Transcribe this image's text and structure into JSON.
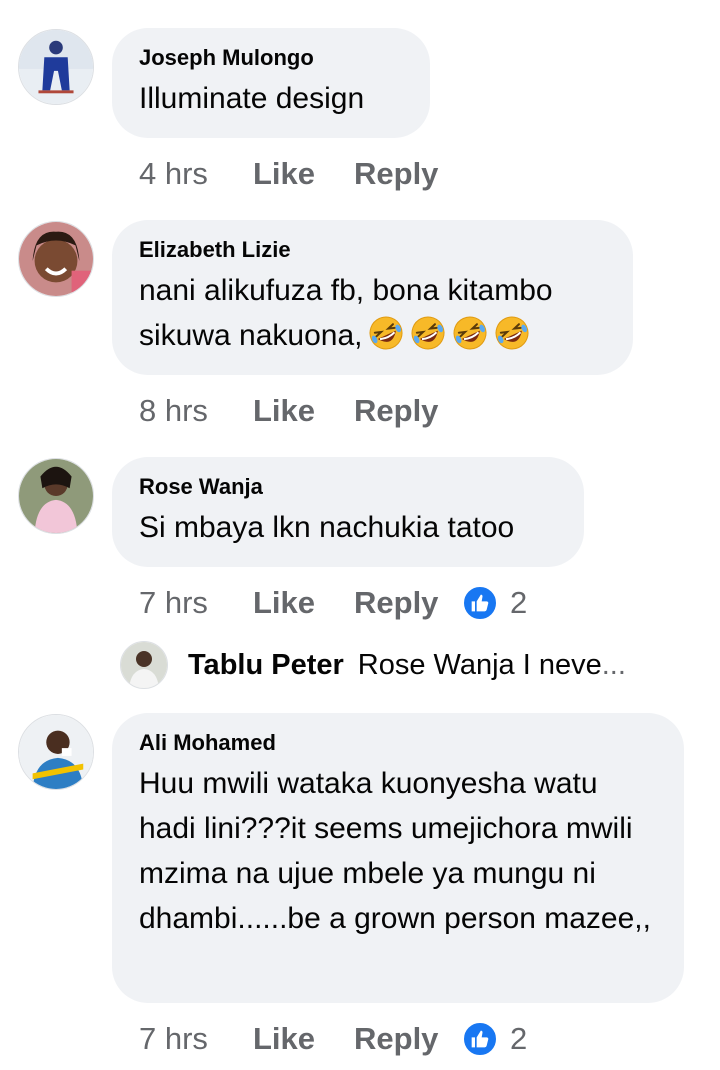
{
  "comments": [
    {
      "author": "Joseph Mulongo",
      "text": "Illuminate design",
      "time": "4 hrs",
      "like": "Like",
      "reply": "Reply"
    },
    {
      "author": "Elizabeth Lizie",
      "text": "nani alikufuza fb, bona kitambo sikuwa nakuona,",
      "emoji": [
        "rolling-on-floor-laughing",
        "rolling-on-floor-laughing",
        "rolling-on-floor-laughing",
        "rolling-on-floor-laughing"
      ],
      "time": "8 hrs",
      "like": "Like",
      "reply": "Reply"
    },
    {
      "author": "Rose Wanja",
      "text": "Si mbaya lkn nachukia tatoo",
      "time": "7 hrs",
      "like": "Like",
      "reply": "Reply",
      "reactions": "2"
    },
    {
      "author": "Ali Mohamed",
      "text": "Huu mwili wataka kuonyesha watu hadi lini???it seems umejichora mwili mzima na ujue mbele ya mungu ni dhambi......be a grown person mazee,,",
      "time": "7 hrs",
      "like": "Like",
      "reply": "Reply",
      "reactions": "2"
    }
  ],
  "reply_preview": {
    "author": "Tablu Peter",
    "text": "Rose Wanja I neve",
    "ellipsis": "..."
  },
  "colors": {
    "bubble": "#f0f2f5",
    "meta": "#65676b",
    "like_blue": "#1877f2"
  }
}
